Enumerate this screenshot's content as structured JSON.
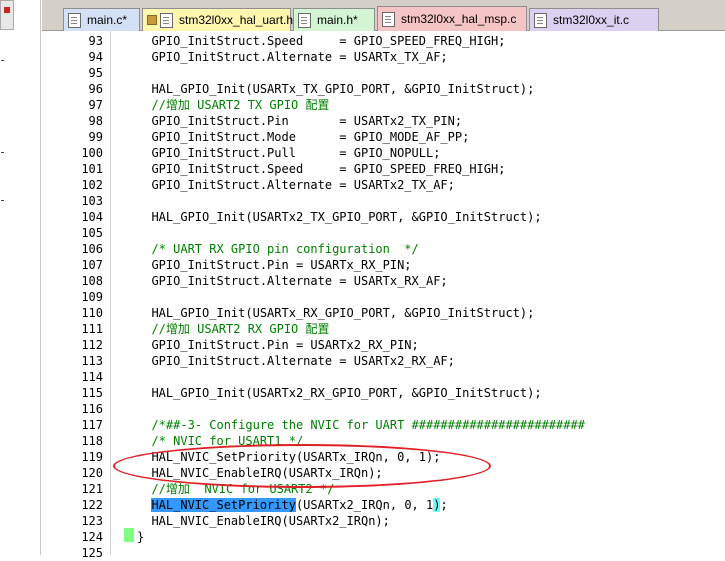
{
  "tabs": [
    {
      "label": "main.c*",
      "icon": "file-icon",
      "bg": "#d4e0f4",
      "active": false
    },
    {
      "label": "stm32l0xx_hal_uart.h",
      "icon": "file-icon",
      "bg": "#fff7b0",
      "locked": true,
      "active": false
    },
    {
      "label": "main.h*",
      "icon": "file-icon",
      "bg": "#d4f4d4",
      "active": false
    },
    {
      "label": "stm32l0xx_hal_msp.c",
      "icon": "file-icon",
      "bg": "#f5c5c5",
      "active": true
    },
    {
      "label": "stm32l0xx_it.c",
      "icon": "file-icon",
      "bg": "#dcd0f0",
      "active": false
    }
  ],
  "lines": [
    {
      "num": "93",
      "code": "  GPIO_InitStruct.Speed     = GPIO_SPEED_FREQ_HIGH;"
    },
    {
      "num": "94",
      "code": "  GPIO_InitStruct.Alternate = USARTx_TX_AF;"
    },
    {
      "num": "95",
      "code": ""
    },
    {
      "num": "96",
      "code": "  HAL_GPIO_Init(USARTx_TX_GPIO_PORT, &GPIO_InitStruct);"
    },
    {
      "num": "97",
      "code": "  //增加 USART2 TX GPIO 配置",
      "comment": true
    },
    {
      "num": "98",
      "code": "  GPIO_InitStruct.Pin       = USARTx2_TX_PIN;"
    },
    {
      "num": "99",
      "code": "  GPIO_InitStruct.Mode      = GPIO_MODE_AF_PP;"
    },
    {
      "num": "100",
      "code": "  GPIO_InitStruct.Pull      = GPIO_NOPULL;"
    },
    {
      "num": "101",
      "code": "  GPIO_InitStruct.Speed     = GPIO_SPEED_FREQ_HIGH;"
    },
    {
      "num": "102",
      "code": "  GPIO_InitStruct.Alternate = USARTx2_TX_AF;"
    },
    {
      "num": "103",
      "code": ""
    },
    {
      "num": "104",
      "code": "  HAL_GPIO_Init(USARTx2_TX_GPIO_PORT, &GPIO_InitStruct);"
    },
    {
      "num": "105",
      "code": ""
    },
    {
      "num": "106",
      "code": "  /* UART RX GPIO pin configuration  */",
      "comment": true
    },
    {
      "num": "107",
      "code": "  GPIO_InitStruct.Pin = USARTx_RX_PIN;"
    },
    {
      "num": "108",
      "code": "  GPIO_InitStruct.Alternate = USARTx_RX_AF;"
    },
    {
      "num": "109",
      "code": ""
    },
    {
      "num": "110",
      "code": "  HAL_GPIO_Init(USARTx_RX_GPIO_PORT, &GPIO_InitStruct);"
    },
    {
      "num": "111",
      "code": "  //增加 USART2 RX GPIO 配置",
      "comment": true
    },
    {
      "num": "112",
      "code": "  GPIO_InitStruct.Pin = USARTx2_RX_PIN;"
    },
    {
      "num": "113",
      "code": "  GPIO_InitStruct.Alternate = USARTx2_RX_AF;"
    },
    {
      "num": "114",
      "code": ""
    },
    {
      "num": "115",
      "code": "  HAL_GPIO_Init(USARTx2_RX_GPIO_PORT, &GPIO_InitStruct);"
    },
    {
      "num": "116",
      "code": ""
    },
    {
      "num": "117",
      "code": "  /*##-3- Configure the NVIC for UART ########################",
      "comment": true
    },
    {
      "num": "118",
      "code": "  /* NVIC for USART1 */",
      "comment": true
    },
    {
      "num": "119",
      "code": "  HAL_NVIC_SetPriority(USARTx_IRQn, 0, 1);"
    },
    {
      "num": "120",
      "code": "  HAL_NVIC_EnableIRQ(USARTx_IRQn);"
    },
    {
      "num": "121",
      "code": "  //增加  NVIC for USART2 */",
      "comment": true
    },
    {
      "num": "122",
      "code_parts": [
        "  ",
        "HAL_NVIC_SetPriority",
        "(USARTx2_IRQn, 0, 1",
        ")",
        ";"
      ]
    },
    {
      "num": "123",
      "code": "  HAL_NVIC_EnableIRQ(USARTx2_IRQn);"
    },
    {
      "num": "124",
      "code": "}"
    },
    {
      "num": "125",
      "code": ""
    }
  ]
}
